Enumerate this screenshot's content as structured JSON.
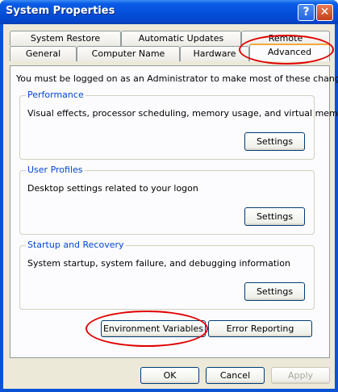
{
  "window": {
    "title": "System Properties"
  },
  "titlebar": {
    "help_glyph": "?",
    "close_glyph": "✕"
  },
  "tabs": {
    "row1": [
      "System Restore",
      "Automatic Updates",
      "Remote"
    ],
    "row2": [
      "General",
      "Computer Name",
      "Hardware",
      "Advanced"
    ],
    "active": "Advanced"
  },
  "advanced": {
    "admin_note": "You must be logged on as an Administrator to make most of these changes.",
    "performance": {
      "title": "Performance",
      "description": "Visual effects, processor scheduling, memory usage, and virtual memory",
      "button": "Settings"
    },
    "user_profiles": {
      "title": "User Profiles",
      "description": "Desktop settings related to your logon",
      "button": "Settings"
    },
    "startup_recovery": {
      "title": "Startup and Recovery",
      "description": "System startup, system failure, and debugging information",
      "button": "Settings"
    },
    "environment_variables_button": "Environment Variables",
    "error_reporting_button": "Error Reporting"
  },
  "footer": {
    "ok": "OK",
    "cancel": "Cancel",
    "apply": "Apply"
  },
  "colors": {
    "titlebar": "#0a5ce6",
    "dialog_bg": "#ece9d8",
    "group_title": "#0046d5",
    "highlight_ellipse": "#e00000"
  }
}
